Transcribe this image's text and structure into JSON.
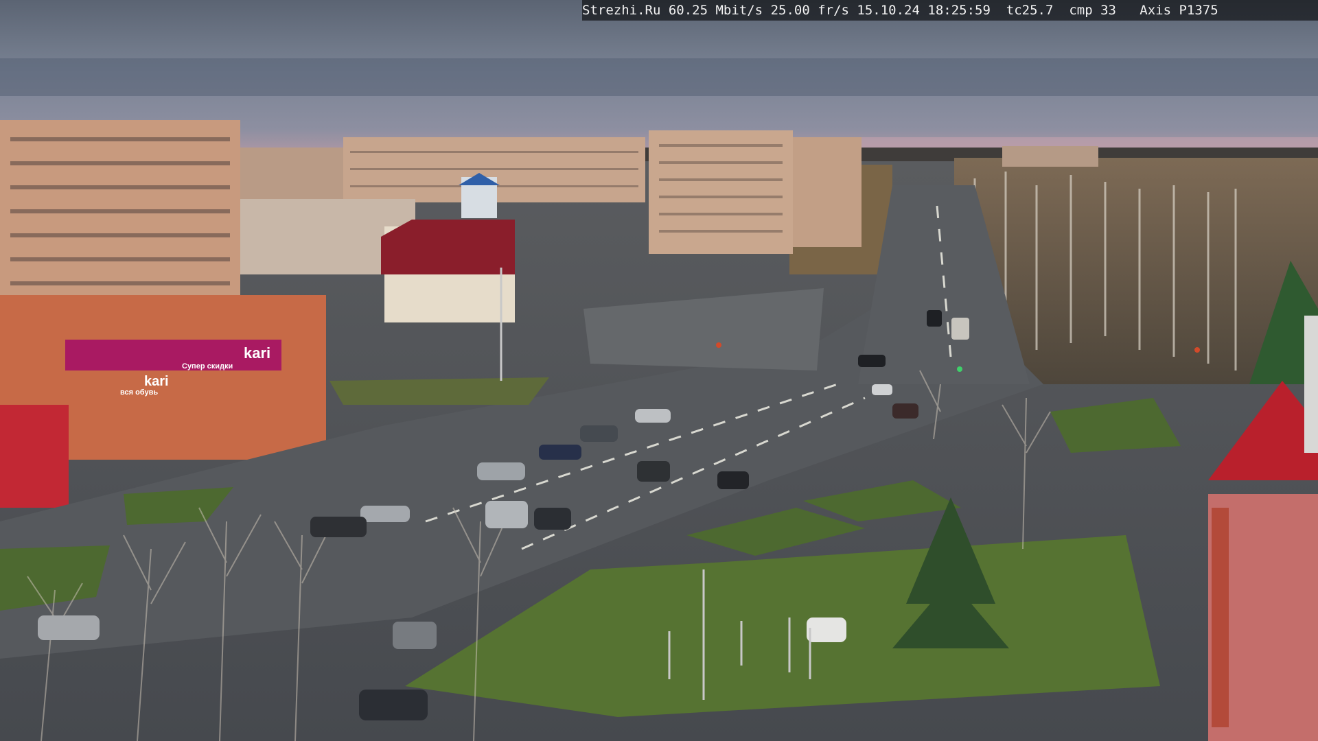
{
  "overlay": {
    "site": "Strezhi.Ru",
    "bitrate": "60.25 Mbit/s",
    "framerate": "25.00 fr/s",
    "date": "15.10.24",
    "time": "18:25:59",
    "tc": "tc25.7",
    "cmp": "cmp 33",
    "camera": "Axis P1375"
  },
  "signs": {
    "store_brand": "kari",
    "store_brand_secondary": "kari",
    "store_slogan": "Супер скидки",
    "store_tagline": "вся обувь"
  },
  "scene": {
    "description_colors": {
      "sky_top": "#5f6878",
      "sky_band": "#8a93a5",
      "horizon_glow": "#c9a9b3",
      "road": "#4e5258",
      "grass": "#4f6b2f",
      "brick": "#c99b7c",
      "kari_magenta": "#b01d6a",
      "red_roof": "#c32030"
    }
  }
}
